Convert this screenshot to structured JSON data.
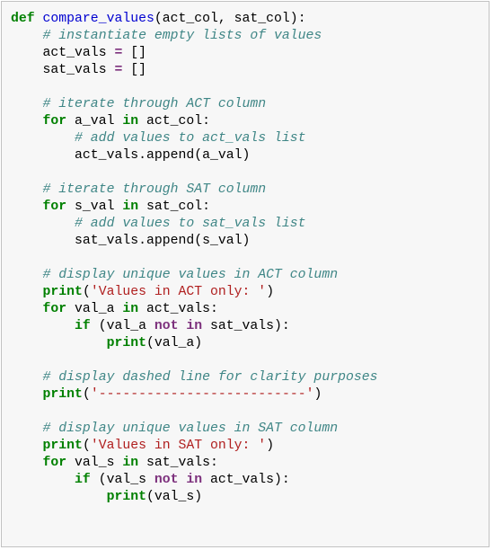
{
  "code": {
    "def_kw": "def",
    "fn_name": "compare_values",
    "params": "(act_col, sat_col):",
    "c1": "# instantiate empty lists of values",
    "l1a": "act_vals ",
    "l1b": " []",
    "l2a": "sat_vals ",
    "l2b": " []",
    "eq": "=",
    "c2": "# iterate through ACT column",
    "for_kw": "for",
    "in_kw": "in",
    "l3a": " a_val ",
    "l3b": " act_col:",
    "c3": "# add values to act_vals list",
    "l4": "act_vals.append(a_val)",
    "c4": "# iterate through SAT column",
    "l5a": " s_val ",
    "l5b": " sat_col:",
    "c5": "# add values to sat_vals list",
    "l6": "sat_vals.append(s_val)",
    "c6": "# display unique values in ACT column",
    "print_kw": "print",
    "str1": "'Values in ACT only: '",
    "l7a": " val_a ",
    "l7b": " act_vals:",
    "if_kw": "if",
    "l8a": " (val_a ",
    "not_in": "not in",
    "l8b": " sat_vals):",
    "l9": "(val_a)",
    "c7": "# display dashed line for clarity purposes",
    "str2": "'--------------------------'",
    "c8": "# display unique values in SAT column",
    "str3": "'Values in SAT only: '",
    "l10a": " val_s ",
    "l10b": " sat_vals:",
    "l11a": " (val_s ",
    "l11b": " act_vals):",
    "l12": "(val_s)",
    "paren_open": "(",
    "paren_close": ")"
  }
}
